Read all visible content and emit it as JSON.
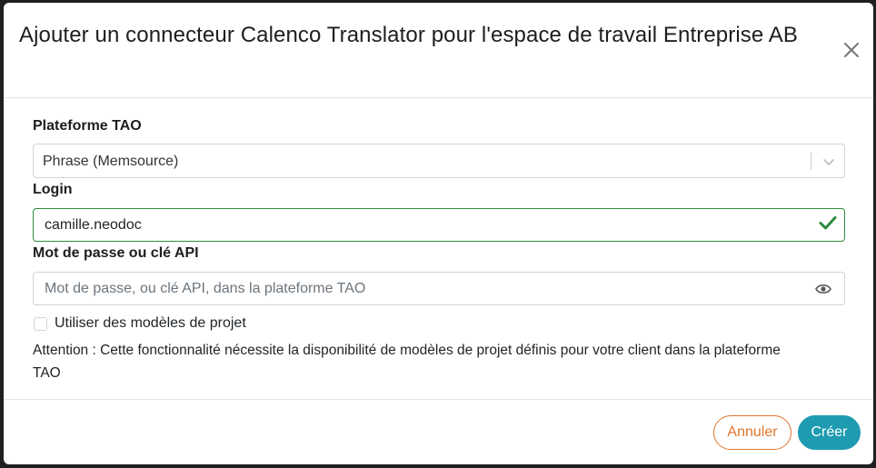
{
  "modal": {
    "title": "Ajouter un connecteur Calenco Translator pour l'espace de travail Entreprise AB"
  },
  "fields": {
    "platform": {
      "label": "Plateforme TAO",
      "value": "Phrase (Memsource)"
    },
    "login": {
      "label": "Login",
      "value": "camille.neodoc"
    },
    "password": {
      "label": "Mot de passe ou clé API",
      "value": "",
      "placeholder": "Mot de passe, ou clé API, dans la plateforme TAO"
    },
    "use_templates": {
      "label": "Utiliser des modèles de projet",
      "checked": false
    },
    "warning": "Attention : Cette fonctionnalité nécessite la disponibilité de modèles de projet définis pour votre client dans la plateforme TAO"
  },
  "footer": {
    "cancel_label": "Annuler",
    "create_label": "Créer"
  },
  "colors": {
    "accent_primary": "#1e9bb1",
    "accent_cancel": "#e0762c",
    "valid": "#2e8b3e"
  }
}
